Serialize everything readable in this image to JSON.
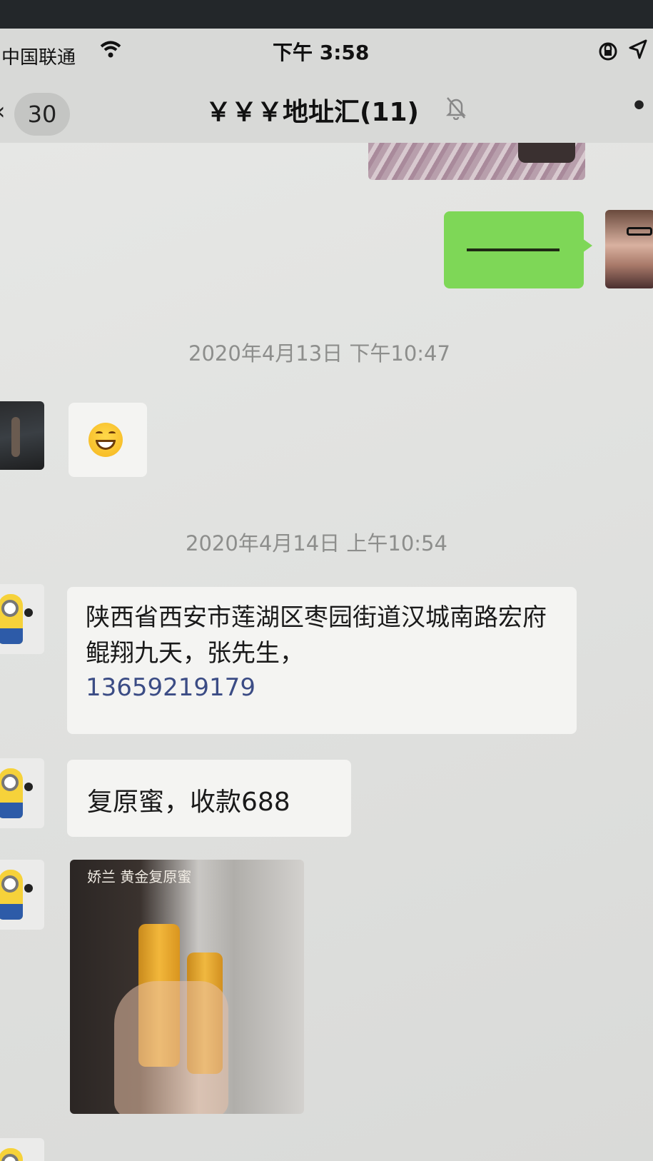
{
  "status_bar": {
    "carrier": "中国联通",
    "time": "下午 3:58"
  },
  "nav": {
    "back_icon": "chevron-left-icon",
    "unread_count": "30",
    "title": "￥￥￥地址汇(11)",
    "mute_icon": "bell-slash-icon",
    "more_icon": "ellipsis-icon"
  },
  "messages": {
    "timestamp_1": "2020年4月13日 下午10:47",
    "timestamp_2": "2020年4月14日 上午10:54",
    "address_text": "陕西省西安市莲湖区枣园街道汉城南路宏府鲲翔九天，张先生，",
    "address_phone": "13659219179",
    "payment_text": "复原蜜，收款688",
    "image_caption": "娇兰 黄金复原蜜"
  },
  "colors": {
    "outgoing_bubble": "#7ed757",
    "incoming_bubble": "#f4f4f2",
    "link": "#3b4c85",
    "timestamp": "#8d8e8c"
  }
}
